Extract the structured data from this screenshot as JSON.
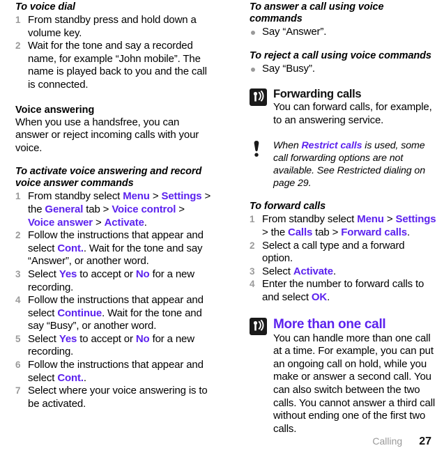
{
  "document": {
    "footer": {
      "chapter": "Calling",
      "page_number": "27"
    },
    "accent_color": "#5c22ee",
    "muted_color": "#9a9a9a"
  },
  "left_column": {
    "voice_dial": {
      "heading": "To voice dial",
      "steps": [
        {
          "num": "1",
          "text": "From standby press and hold down a volume key."
        },
        {
          "num": "2",
          "text": "Wait for the tone and say a recorded name, for example “John mobile”. The name is played back to you and the call is connected."
        }
      ]
    },
    "voice_answering": {
      "heading": "Voice answering",
      "body": "When you use a handsfree, you can answer or reject incoming calls with your voice."
    },
    "activate_voice_answering": {
      "heading": "To activate voice answering and record voice answer commands",
      "step1": {
        "num": "1",
        "lead": "From standby select ",
        "ui_menu": "Menu",
        "sep1": " > ",
        "ui_settings": "Settings",
        "mid1": " > the ",
        "ui_general": "General",
        "mid2": " tab > ",
        "ui_voice_control": "Voice control",
        "mid3": " > ",
        "ui_voice_answer": "Voice answer",
        "mid4": " > ",
        "ui_activate": "Activate",
        "tail": "."
      },
      "step2": {
        "num": "2",
        "lead": "Follow the instructions that appear and select ",
        "ui_cont": "Cont.",
        "tail": ". Wait for the tone and say “Answer”, or another word."
      },
      "step3": {
        "num": "3",
        "lead": "Select ",
        "ui_yes": "Yes",
        "mid": " to accept or ",
        "ui_no": "No",
        "tail": " for a new recording."
      },
      "step4": {
        "num": "4",
        "lead": "Follow the instructions that appear and select ",
        "ui_continue": "Continue",
        "tail": ". Wait for the tone and say “Busy”, or another word."
      },
      "step5": {
        "num": "5",
        "lead": "Select ",
        "ui_yes": "Yes",
        "mid": " to accept or ",
        "ui_no": "No",
        "tail": " for a new recording."
      },
      "step6": {
        "num": "6",
        "lead": "Follow the instructions that appear and select ",
        "ui_cont": "Cont.",
        "tail": "."
      },
      "step7": {
        "num": "7",
        "text": "Select where your voice answering is to be activated."
      }
    }
  },
  "right_column": {
    "answer_call": {
      "heading": "To answer a call using voice commands",
      "bullet": "Say “Answer”."
    },
    "reject_call": {
      "heading": "To reject a call using voice commands",
      "bullet": "Say “Busy”."
    },
    "forwarding_calls": {
      "icon": "antenna-signal-icon",
      "heading": "Forwarding calls",
      "body": "You can forward calls, for example, to an answering service."
    },
    "note": {
      "icon": "exclamation-note-icon",
      "lead": "When ",
      "ui_restrict_calls": "Restrict calls",
      "tail": " is used, some call forwarding options are not available. See Restricted dialing on page 29."
    },
    "forward_calls_proc": {
      "heading": "To forward calls",
      "step1": {
        "num": "1",
        "lead": "From standby select ",
        "ui_menu": "Menu",
        "sep1": " > ",
        "ui_settings": "Settings",
        "mid1": " > the ",
        "ui_calls": "Calls",
        "mid2": " tab > ",
        "ui_forward_calls": "Forward calls",
        "tail": "."
      },
      "step2": {
        "num": "2",
        "text": "Select a call type and a forward option."
      },
      "step3": {
        "num": "3",
        "lead": "Select ",
        "ui_activate": "Activate",
        "tail": "."
      },
      "step4": {
        "num": "4",
        "lead": "Enter the number to forward calls to and select ",
        "ui_ok": "OK",
        "tail": "."
      }
    },
    "more_than_one_call": {
      "icon": "antenna-signal-icon",
      "heading": "More than one call",
      "body": "You can handle more than one call at a time. For example, you can put an ongoing call on hold, while you make or answer a second call. You can also switch between the two calls. You cannot answer a third call without ending one of the first two calls."
    }
  }
}
